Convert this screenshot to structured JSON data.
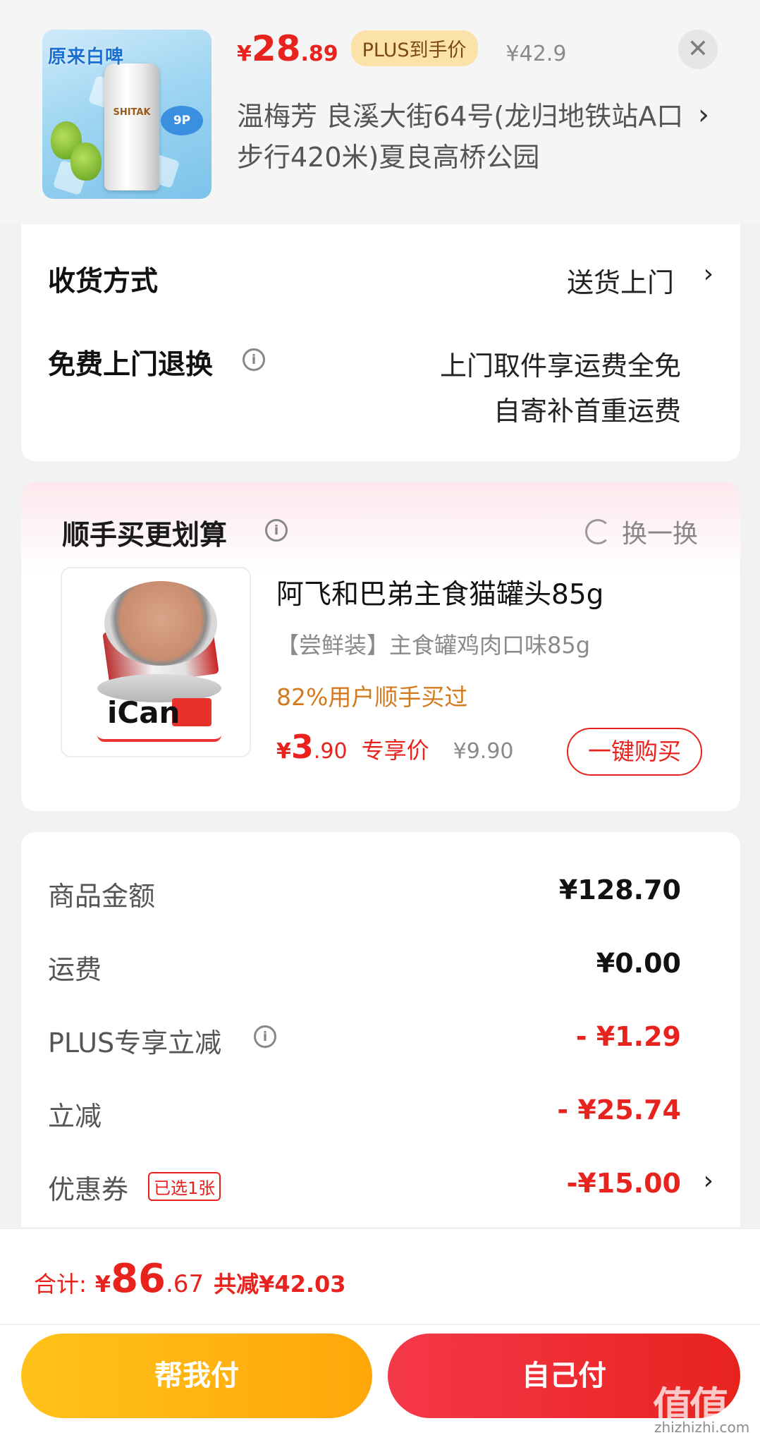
{
  "product_header": {
    "image_banner": "原来白啤",
    "image_can_label": "SHITAK",
    "image_badge": "9P",
    "price_yen": "¥",
    "price_int": "28",
    "price_dec": ".89",
    "plus_chip": "PLUS到手价",
    "original_price": "¥42.9",
    "close_glyph": "✕",
    "address": "温梅芳  良溪大街64号(龙归地铁站A口步行420米)夏良高桥公园",
    "address_chevron": "›"
  },
  "shipping": {
    "delivery_label": "收货方式",
    "delivery_value": "送货上门",
    "delivery_chevron": "›",
    "return_label": "免费上门退换",
    "return_value_line1": "上门取件享运费全免",
    "return_value_line2": "自寄补首重运费",
    "info_glyph": "i"
  },
  "upsell": {
    "title": "顺手买更划算",
    "swap_label": "换一换",
    "image_brand": "iCan",
    "product_name": "阿飞和巴弟主食猫罐头85g",
    "spec": "【尝鲜装】主食罐鸡肉口味85g",
    "social_proof": "82%用户顺手买过",
    "price_yen": "¥",
    "price_int": "3",
    "price_dec": ".90",
    "price_tag": "专享价",
    "original_price": "¥9.90",
    "buy_button": "一键购买"
  },
  "summary": {
    "rows": [
      {
        "label": "商品金额",
        "value": "¥128.70"
      },
      {
        "label": "运费",
        "value": "¥0.00"
      },
      {
        "label": "PLUS专享立减",
        "value": "- ¥1.29"
      },
      {
        "label": "立减",
        "value": "- ¥25.74"
      },
      {
        "label": "优惠券",
        "value": "-¥15.00",
        "chip": "已选1张",
        "chevron": "›"
      }
    ]
  },
  "bottom": {
    "total_label": "合计:",
    "total_yen": "¥",
    "total_int": "86",
    "total_dec": ".67",
    "saved": "共减¥42.03",
    "friend_pay": "帮我付",
    "self_pay": "自己付"
  },
  "watermark": {
    "logo": "值值值",
    "site": "zhizhizhi.com"
  },
  "colors": {
    "accent_red": "#e8231e",
    "plus_chip_bg": "#fbe2a8",
    "friend_button": "#ffb312",
    "social_orange": "#d47a1d"
  }
}
